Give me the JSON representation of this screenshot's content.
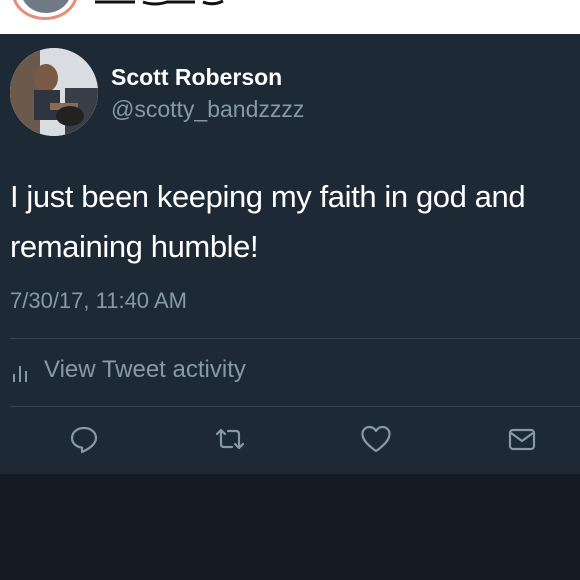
{
  "tweet": {
    "display_name": "Scott Roberson",
    "handle": "@scotty_bandzzzz",
    "text_line1": "I just been keeping my faith in god and",
    "text_line2": "remaining humble!",
    "timestamp": "7/30/17, 11:40 AM",
    "activity_label": "View Tweet activity"
  },
  "colors": {
    "card_background": "#1d2935",
    "page_background": "#141b24",
    "primary_text": "#ffffff",
    "secondary_text": "#8899a6",
    "divider": "#38444d"
  },
  "icons": {
    "activity": "bar-chart-icon",
    "reply": "reply-icon",
    "retweet": "retweet-icon",
    "like": "heart-icon",
    "message": "envelope-icon"
  }
}
